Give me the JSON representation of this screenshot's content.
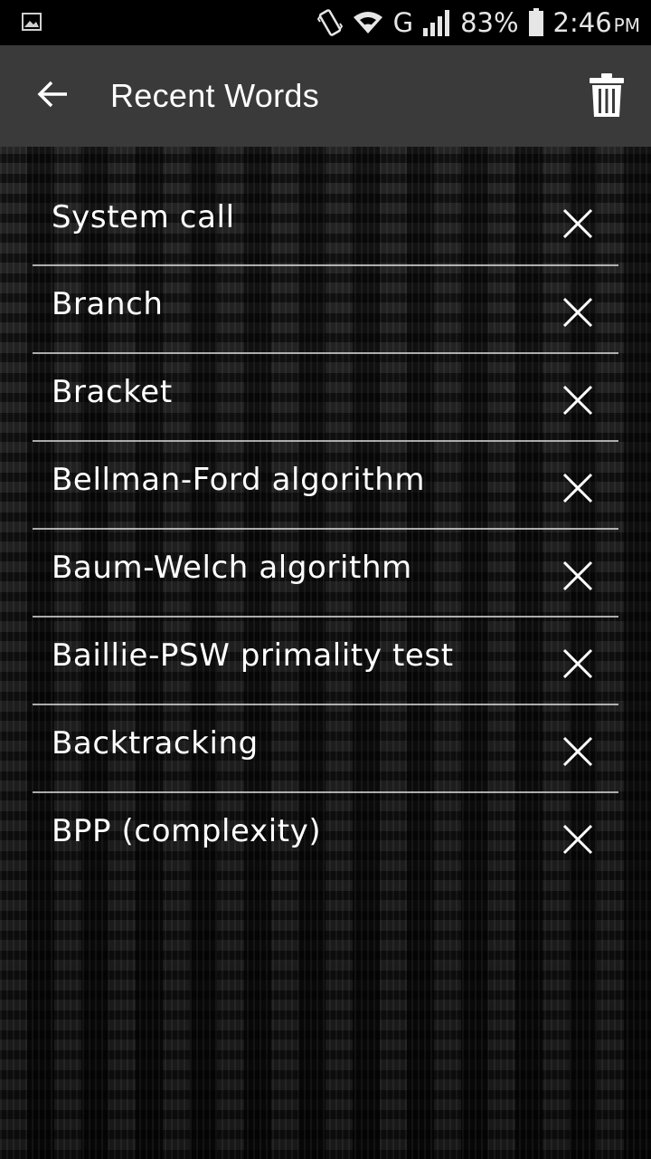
{
  "status_bar": {
    "battery": "83%",
    "time": "2:46",
    "time_suffix": "PM",
    "network": "G",
    "icons": [
      "gallery-notification-icon",
      "vibrate-icon",
      "wifi-icon",
      "signal-icon",
      "battery-icon"
    ]
  },
  "app_bar": {
    "title": "Recent Words",
    "back_icon": "arrow-back-icon",
    "delete_all_icon": "trash-icon",
    "background": "#3a3a3a"
  },
  "words": [
    {
      "label": "System call",
      "remove_icon": "close-icon"
    },
    {
      "label": "Branch",
      "remove_icon": "close-icon"
    },
    {
      "label": "Bracket",
      "remove_icon": "close-icon"
    },
    {
      "label": "Bellman-Ford algorithm",
      "remove_icon": "close-icon"
    },
    {
      "label": "Baum-Welch algorithm",
      "remove_icon": "close-icon"
    },
    {
      "label": "Baillie-PSW primality test",
      "remove_icon": "close-icon"
    },
    {
      "label": "Backtracking",
      "remove_icon": "close-icon"
    },
    {
      "label": "BPP (complexity)",
      "remove_icon": "close-icon"
    }
  ]
}
